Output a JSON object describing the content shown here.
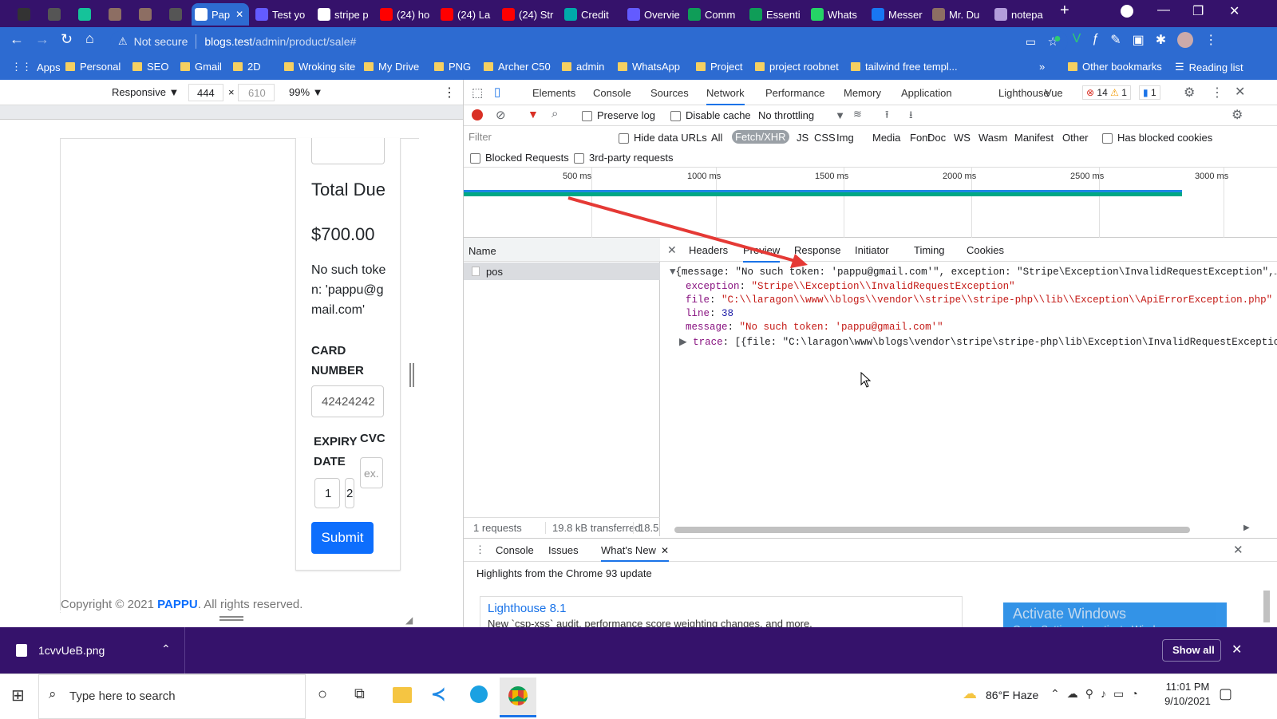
{
  "tabs": [
    {
      "icon": "tab-icon",
      "label": ""
    },
    {
      "icon": "openai-icon",
      "label": ""
    },
    {
      "icon": "grammarly-icon",
      "label": ""
    },
    {
      "icon": "app-icon",
      "label": ""
    },
    {
      "icon": "app-icon",
      "label": ""
    },
    {
      "icon": "openai-icon",
      "label": ""
    },
    {
      "icon": "page-icon",
      "label": "Pap"
    },
    {
      "icon": "stripe-icon",
      "label": "Test yo"
    },
    {
      "icon": "google-icon",
      "label": "stripe p"
    },
    {
      "icon": "youtube-icon",
      "label": "(24) ho"
    },
    {
      "icon": "youtube-icon",
      "label": "(24) La"
    },
    {
      "icon": "youtube-icon",
      "label": "(24) Str"
    },
    {
      "icon": "credit-icon",
      "label": "Credit"
    },
    {
      "icon": "stripe-icon",
      "label": "Overvie"
    },
    {
      "icon": "sheets-icon",
      "label": "Comm"
    },
    {
      "icon": "sheets-icon",
      "label": "Essenti"
    },
    {
      "icon": "whatsapp-icon",
      "label": "Whats"
    },
    {
      "icon": "facebook-icon",
      "label": "Messer"
    },
    {
      "icon": "app-icon",
      "label": "Mr. Du"
    },
    {
      "icon": "notepad-icon",
      "label": "notepa"
    }
  ],
  "address": {
    "security": "Not secure",
    "url_host": "blogs.test",
    "url_path": "/admin/product/sale#"
  },
  "bookmarks": [
    "Apps",
    "Personal",
    "SEO",
    "Gmail",
    "2D",
    "Wroking site",
    "My Drive",
    "PNG",
    "Archer C50",
    "admin",
    "WhatsApp",
    "Project",
    "project roobnet",
    "tailwind free templ...",
    "»",
    "Other bookmarks",
    "Reading list"
  ],
  "device_toolbar": {
    "mode": "Responsive",
    "width": "444",
    "height": "610",
    "zoom": "99%"
  },
  "page": {
    "total_due_label": "Total Due",
    "total_due_value": "$700.00",
    "error_text": "No such token: 'pappu@gmail.com'",
    "card_number_label": "CARD NUMBER",
    "card_number_value": "42424242",
    "expiry_label": "EXPIRY DATE",
    "cvc_label": "CVC",
    "expiry_month": "1",
    "expiry_year": "2",
    "cvc_placeholder": "ex.",
    "submit_label": "Submit",
    "copyright_prefix": "Copyright © 2021",
    "copyright_brand": "PAPPU",
    "copyright_suffix": ". All rights reserved."
  },
  "devtools": {
    "tabs": [
      "Elements",
      "Console",
      "Sources",
      "Network",
      "Performance",
      "Memory",
      "Application",
      "Lighthouse",
      "Vue"
    ],
    "active_tab": "Network",
    "errors": "14",
    "warnings": "1",
    "messages": "1",
    "preserve_log": "Preserve log",
    "disable_cache": "Disable cache",
    "throttling": "No throttling",
    "filter_placeholder": "Filter",
    "hide_data_urls": "Hide data URLs",
    "type_filters": [
      "All",
      "Fetch/XHR",
      "JS",
      "CSS",
      "Img",
      "Media",
      "Font",
      "Doc",
      "WS",
      "Wasm",
      "Manifest",
      "Other"
    ],
    "active_type": "Fetch/XHR",
    "has_blocked_cookies": "Has blocked cookies",
    "blocked_requests": "Blocked Requests",
    "third_party": "3rd-party requests",
    "timeline_ticks": [
      "500 ms",
      "1000 ms",
      "1500 ms",
      "2000 ms",
      "2500 ms",
      "3000 ms"
    ],
    "name_header": "Name",
    "request_name": "pos",
    "detail_tabs": [
      "Headers",
      "Preview",
      "Response",
      "Initiator",
      "Timing",
      "Cookies"
    ],
    "active_detail": "Preview",
    "preview_line": "{message: \"No such token: 'pappu@gmail.com'\", exception: \"Stripe\\Exception\\InvalidRequestException\",…}",
    "props": [
      {
        "key": "exception",
        "value": "\"Stripe\\\\Exception\\\\InvalidRequestException\""
      },
      {
        "key": "file",
        "value": "\"C:\\\\laragon\\\\www\\\\blogs\\\\vendor\\\\stripe\\\\stripe-php\\\\lib\\\\Exception\\\\ApiErrorException.php\""
      },
      {
        "key": "line",
        "value": "38"
      },
      {
        "key": "message",
        "value": "\"No such token: 'pappu@gmail.com'\""
      }
    ],
    "trace_key": "trace",
    "trace_value": "[{file: \"C:\\laragon\\www\\blogs\\vendor\\stripe\\stripe-php\\lib\\Exception\\InvalidRequestException.",
    "status_requests": "1 requests",
    "status_transferred": "19.8 kB transferred",
    "status_resources": "18.5",
    "drawer_tabs": [
      "Console",
      "Issues",
      "What's New"
    ],
    "drawer_active": "What's New",
    "whats_new_heading": "Highlights from the Chrome 93 update",
    "lighthouse_title": "Lighthouse 8.1",
    "lighthouse_desc": "New `csp-xss` audit, performance score weighting changes, and more.",
    "activate_title": "Activate Windows",
    "activate_sub": "Go to Settings to activate Windows."
  },
  "download": {
    "file": "1cvvUeB.png",
    "show_all": "Show all"
  },
  "taskbar": {
    "search_placeholder": "Type here to search",
    "weather": "86°F Haze",
    "time": "11:01 PM",
    "date": "9/10/2021"
  },
  "colors": {
    "tabbar": "#35126b",
    "toolbar": "#2d6bd1",
    "accent": "#1a73e8",
    "submit": "#0d6efd",
    "arrow": "#e53935"
  }
}
